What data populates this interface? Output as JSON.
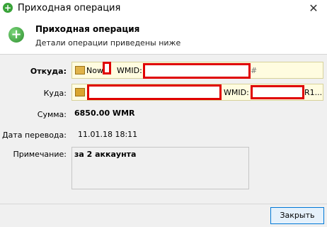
{
  "window": {
    "title": "Приходная операция",
    "close_glyph": "✕"
  },
  "header": {
    "title": "Приходная операция",
    "subtitle": "Детали операции приведены ниже",
    "icon": "plus-icon"
  },
  "fields": {
    "from": {
      "label": "Откуда:",
      "prefix": "Now",
      "wmid_label": "WMID:",
      "suffix": "#"
    },
    "to": {
      "label": "Куда:",
      "wmid_label": "WMID:",
      "suffix": "R1..."
    },
    "amount": {
      "label": "Сумма:",
      "value": "6850.00 WMR"
    },
    "date": {
      "label": "Дата перевода:",
      "value": "11.01.18 18:11"
    },
    "note": {
      "label": "Примечание:",
      "value": "за 2 аккаунта"
    }
  },
  "buttons": {
    "close": "Закрыть"
  }
}
